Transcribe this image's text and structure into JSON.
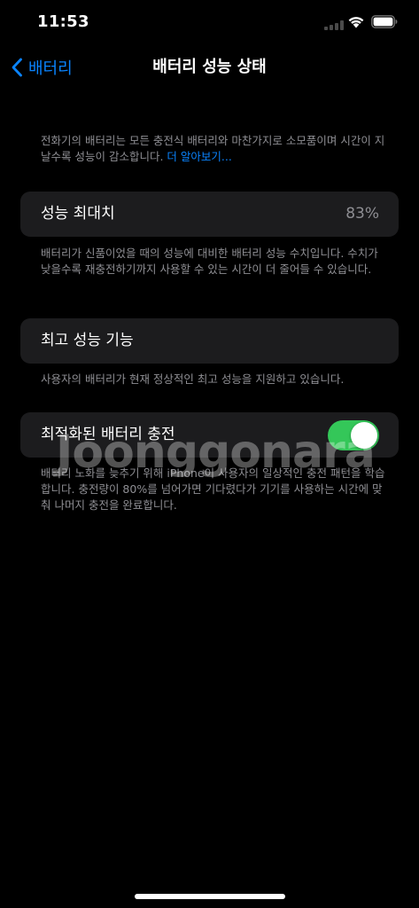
{
  "status_bar": {
    "time": "11:53",
    "icons": [
      "cellular-signal-icon",
      "wifi-icon",
      "battery-icon"
    ]
  },
  "nav": {
    "back_label": "배터리",
    "title": "배터리 성능 상태"
  },
  "intro": {
    "text": "전화기의 배터리는 모든 충전식 배터리와 마찬가지로 소모품이며 시간이 지날수록 성능이 감소합니다. ",
    "link": "더 알아보기..."
  },
  "max_capacity": {
    "label": "성능 최대치",
    "value": "83%",
    "description": "배터리가 신품이었을 때의 성능에 대비한 배터리 성능 수치입니다. 수치가 낮을수록 재충전하기까지 사용할 수 있는 시간이 더 줄어들 수 있습니다."
  },
  "peak_performance": {
    "label": "최고 성능 기능",
    "description": "사용자의 배터리가 현재 정상적인 최고 성능을 지원하고 있습니다."
  },
  "optimized_charging": {
    "label": "최적화된 배터리 충전",
    "enabled": true,
    "description": "배터리 노화를 늦추기 위해 iPhone이 사용자의 일상적인 충전 패턴을 학습합니다. 충전량이 80%를 넘어가면 기다렸다가 기기를 사용하는 시간에 맞춰 나머지 충전을 완료합니다."
  },
  "watermark": "Joonggonara",
  "colors": {
    "accent": "#0a84ff",
    "toggle_on": "#34c759",
    "cell_background": "#1c1c1e",
    "secondary_text": "#8e8e93"
  }
}
